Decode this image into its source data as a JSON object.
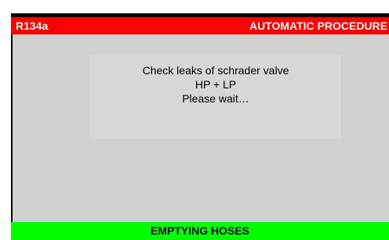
{
  "header": {
    "refrigerant": "R134a",
    "procedure": "AUTOMATIC PROCEDURE"
  },
  "message": {
    "line1": "Check leaks of schrader valve",
    "line2": "HP + LP",
    "line3": "Please wait…"
  },
  "footer": {
    "status": "EMPTYING HOSES"
  },
  "colors": {
    "header_bg": "#ff0000",
    "footer_bg": "#00ff00",
    "content_bg": "#d1d1d1",
    "frame": "#000000"
  }
}
